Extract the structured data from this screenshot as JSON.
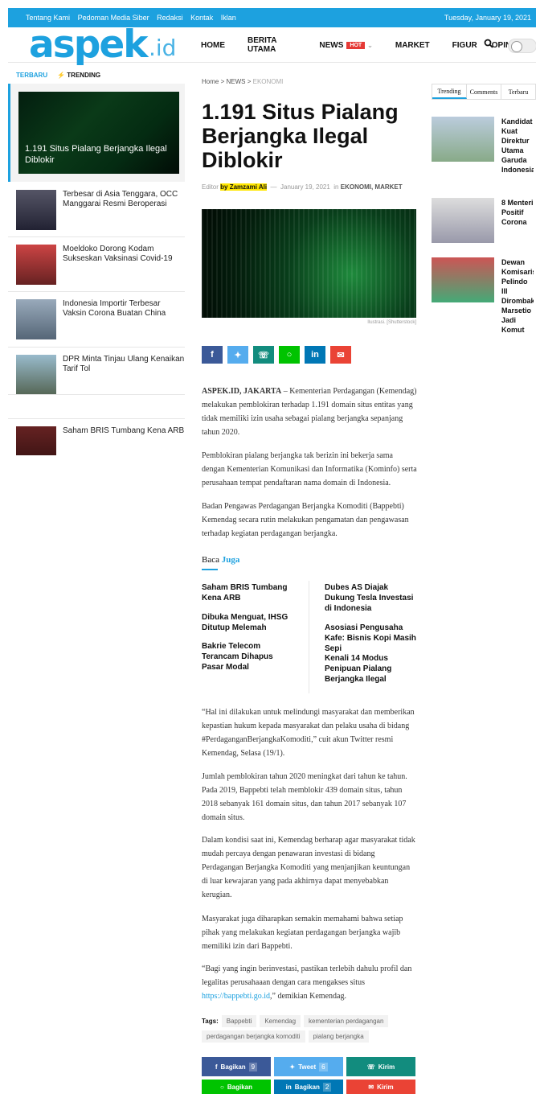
{
  "topbar": {
    "links": [
      "Tentang Kami",
      "Pedoman Media Siber",
      "Redaksi",
      "Kontak",
      "Iklan"
    ],
    "date": "Tuesday, January 19, 2021"
  },
  "header": {
    "logo": "aspek",
    "logo_suffix": ".id",
    "nav": [
      "HOME",
      "BERITA UTAMA",
      "NEWS",
      "MARKET",
      "FIGUR",
      "OPINI"
    ],
    "hot": "HOT"
  },
  "left": {
    "tabs": [
      "TERBARU",
      "TRENDING"
    ],
    "featured": "1.191 Situs Pialang Berjangka Ilegal Diblokir",
    "items": [
      "Terbesar di Asia Tenggara, OCC Manggarai Resmi Beroperasi",
      "Moeldoko Dorong Kodam Sukseskan Vaksinasi Covid-19",
      "Indonesia Importir Terbesar Vaksin Corona Buatan China",
      "DPR Minta Tinjau Ulang Kenaikan Tarif Tol",
      "Saham BRIS Tumbang Kena ARB"
    ]
  },
  "article": {
    "breadcrumb": [
      "Home",
      ">",
      "NEWS",
      ">",
      "EKONOMI"
    ],
    "title": "1.191 Situs Pialang Berjangka Ilegal Diblokir",
    "editor_prefix": "Editor",
    "editor": "by Zamzami Ali",
    "dash": "—",
    "date": "January 19, 2021",
    "in": "in",
    "categories": "EKONOMI, MARKET",
    "caption": "Ilustrasi. [Shutterstock]",
    "lead": "ASPEK.ID, JAKARTA",
    "p1": " – Kementerian Perdagangan (Kemendag) melakukan pemblokiran terhadap 1.191 domain situs entitas yang tidak memiliki izin usaha sebagai pialang berjangka sepanjang tahun 2020.",
    "p2": "Pemblokiran pialang berjangka tak berizin ini bekerja sama dengan Kementerian Komunikasi dan Informatika (Kominfo) serta perusahaan tempat pendaftaran nama domain di Indonesia.",
    "p3": "Badan Pengawas Perdagangan Berjangka Komoditi (Bappebti) Kemendag secara rutin melakukan pengamatan dan pengawasan terhadap kegiatan perdagangan berjangka.",
    "baca": "Baca",
    "juga": "Juga",
    "related_left": [
      "Saham BRIS Tumbang Kena ARB",
      "Dibuka Menguat, IHSG Ditutup Melemah",
      "Bakrie Telecom Terancam Dihapus Pasar Modal"
    ],
    "related_right": [
      "Dubes AS Diajak Dukung Tesla Investasi di Indonesia",
      "Asosiasi Pengusaha Kafe: Bisnis Kopi Masih Sepi",
      "Kenali 14 Modus Penipuan Pialang Berjangka Ilegal"
    ],
    "p4": "“Hal ini dilakukan untuk melindungi masyarakat dan memberikan kepastian hukum kepada masyarakat dan pelaku usaha di bidang #PerdaganganBerjangkaKomoditi,” cuit akun Twitter resmi Kemendag, Selasa (19/1).",
    "p5": "Jumlah pemblokiran tahun 2020 meningkat dari tahun ke tahun. Pada 2019, Bappebti telah memblokir 439 domain situs, tahun 2018 sebanyak 161 domain situs, dan tahun 2017 sebanyak 107 domain situs.",
    "p6": "Dalam kondisi saat ini, Kemendag berharap agar masyarakat tidak mudah percaya dengan penawaran investasi di bidang Perdagangan Berjangka Komoditi yang menjanjikan keuntungan di luar kewajaran yang pada akhirnya dapat menyebabkan kerugian.",
    "p7": "Masyarakat juga diharapkan semakin memahami bahwa setiap pihak yang melakukan kegiatan perdagangan berjangka wajib memiliki izin dari Bappebti.",
    "p8a": "“Bagi yang ingin berinvestasi, pastikan terlebih dahulu profil dan legalitas perusahaaan dengan cara mengakses situs ",
    "p8link": "https://bappebti.go.id",
    "p8b": ",” demikian Kemendag.",
    "tags_label": "Tags:",
    "tags": [
      "Bappebti",
      "Kemendag",
      "kementerian perdagangan",
      "perdagangan berjangka komoditi",
      "pialang berjangka"
    ],
    "share": {
      "fb": "Bagikan",
      "fb_count": "9",
      "tw": "Tweet",
      "tw_count": "6",
      "wa": "Kirim",
      "line": "Bagikan",
      "in": "Bagikan",
      "in_count": "2",
      "mail": "Kirim"
    }
  },
  "right": {
    "tabs": [
      "Trending",
      "Comments",
      "Terbaru"
    ],
    "items": [
      "Kandidat Kuat Direktur Utama Garuda Indonesia",
      "8 Menteri Positif Corona",
      "Dewan Komisaris Pelindo III Dirombak, Marsetio Jadi Komut"
    ]
  },
  "colors": {
    "accent": "#1da1df",
    "hot": "#e53935",
    "fb": "#3b5998",
    "tw": "#55acee",
    "wa": "#128c7e",
    "line": "#00c300",
    "linkedin": "#0077b5",
    "mail": "#ea4335"
  }
}
